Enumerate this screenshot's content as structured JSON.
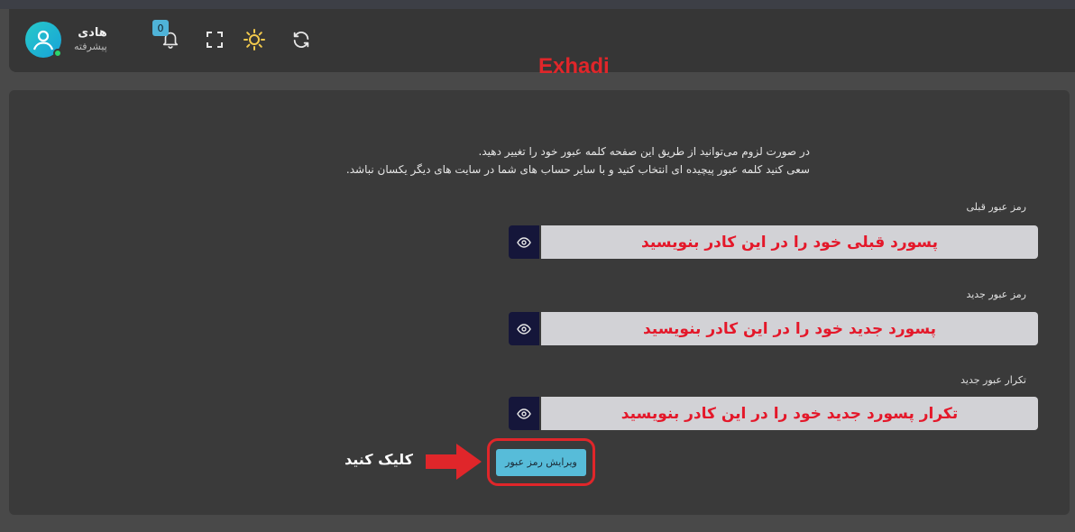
{
  "header": {
    "user_name": "هادی",
    "user_role": "پیشرفته",
    "notification_count": "0",
    "icons": [
      "user-avatar-icon",
      "bell-icon",
      "fullscreen-icon",
      "sun-icon",
      "refresh-icon"
    ]
  },
  "watermark": "Exhadi",
  "intro": {
    "line1": "در صورت لزوم می‌توانید از طریق این صفحه کلمه عبور خود را تغییر دهید.",
    "line2": "سعی کنید کلمه عبور پیچیده ای انتخاب کنید و با سایر حساب های شما در سایت های دیگر یکسان نباشد."
  },
  "fields": {
    "old": {
      "label": "رمز عبور قبلی",
      "placeholder": "پسورد قبلی خود را در این کادر بنویسید"
    },
    "new": {
      "label": "رمز عبور جدید",
      "placeholder": "پسورد جدید خود را در این کادر بنویسید"
    },
    "repeat": {
      "label": "تکرار عبور جدید",
      "placeholder": "تکرار پسورد جدید خود را در این کادر بنویسید"
    }
  },
  "submit_label": "ویرایش رمز عبور",
  "annotation": "کلیک کنید",
  "colors": {
    "accent": "#57bcd9",
    "annotation_red": "#e0262a",
    "eye_button": "#15163a",
    "sun": "#f2c94c"
  }
}
